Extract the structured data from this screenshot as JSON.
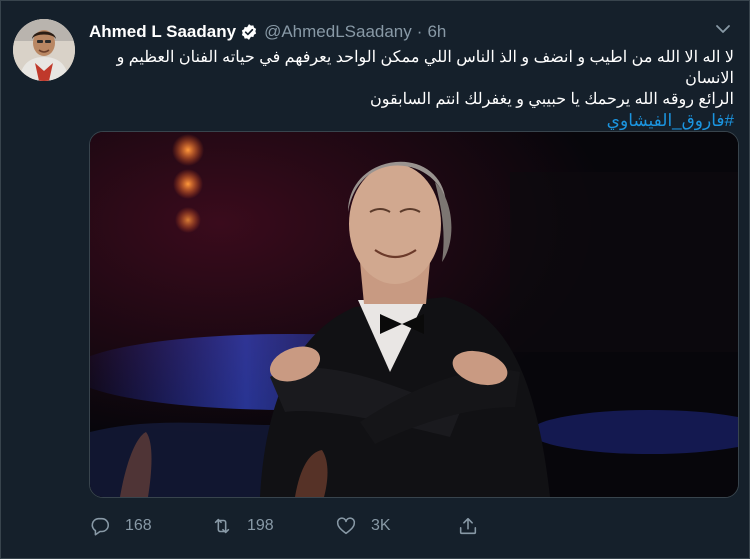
{
  "tweet": {
    "author": {
      "display_name": "Ahmed L Saadany",
      "handle": "@AhmedLSaadany",
      "verified": true,
      "avatar_icon": "user-avatar"
    },
    "separator": "·",
    "time": "6h",
    "text_lines": [
      "لا اله الا الله من اطيب و انضف و الذ الناس اللي ممكن الواحد يعرفهم في حياته الفنان العظيم و الانسان",
      "الرائع روقه الله يرحمك يا حبيبي و يغفرلك انتم السابقون"
    ],
    "hashtag": "#فاروق_الفيشاوي",
    "media": {
      "kind": "photo",
      "description_icon": "photo-man-in-tuxedo"
    },
    "actions": {
      "reply": {
        "icon": "reply-icon",
        "count": "168"
      },
      "retweet": {
        "icon": "retweet-icon",
        "count": "198"
      },
      "like": {
        "icon": "heart-icon",
        "count": "3K"
      },
      "share": {
        "icon": "share-icon",
        "count": ""
      }
    }
  },
  "colors": {
    "background": "#15202b",
    "border": "#38444d",
    "secondary_text": "#8899a6",
    "link": "#1b95e0",
    "verified": "#ffffff"
  }
}
